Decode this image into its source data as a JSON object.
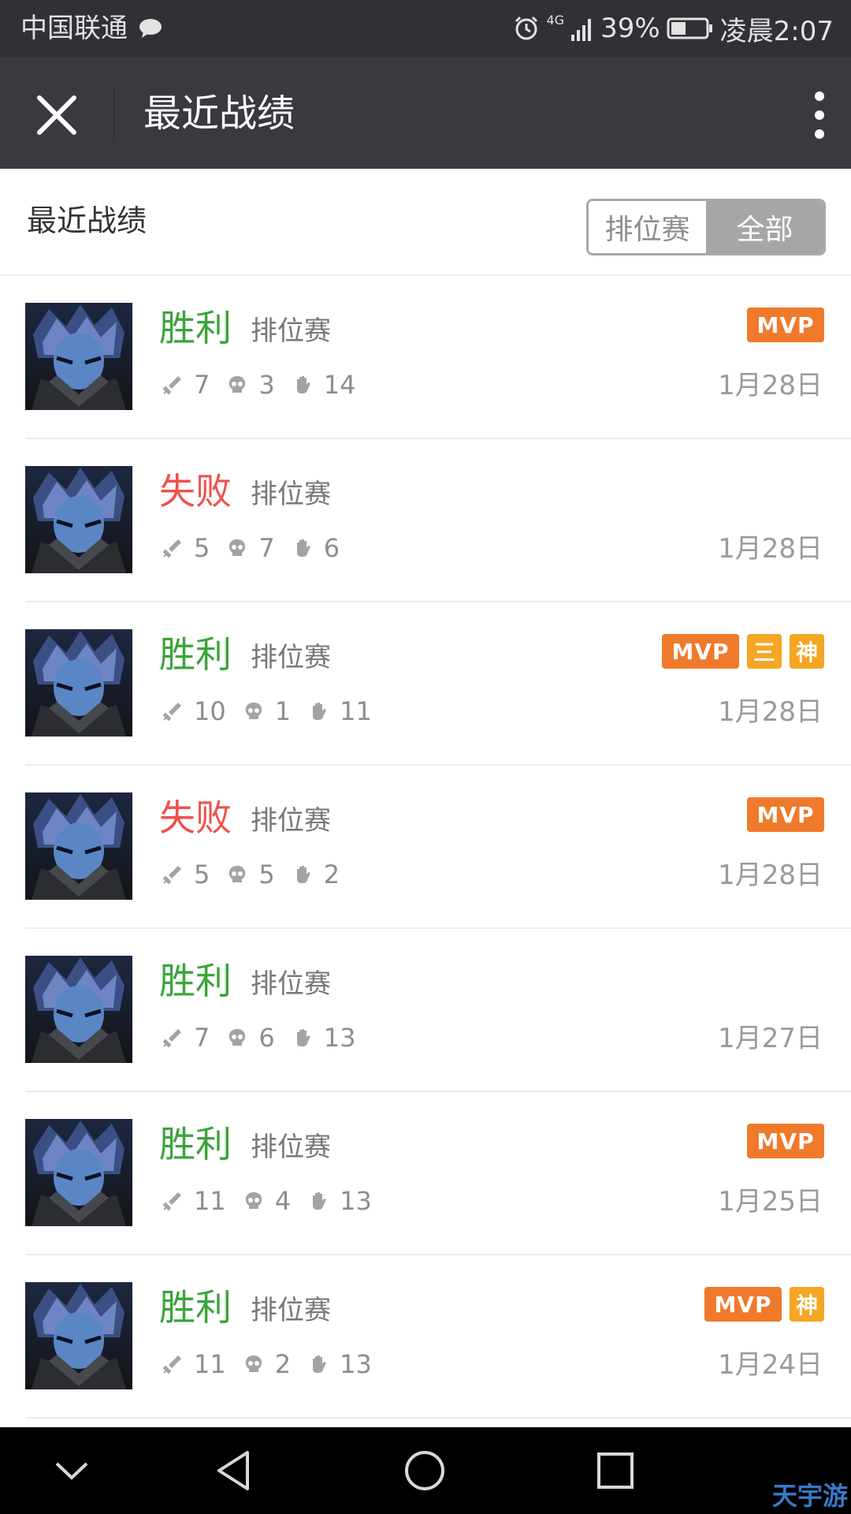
{
  "status_bar": {
    "carrier": "中国联通",
    "network": "4G",
    "battery": "39%",
    "time": "凌晨2:07"
  },
  "top_bar": {
    "title": "最近战绩"
  },
  "header": {
    "title": "最近战绩",
    "filters": [
      "排位赛",
      "全部"
    ],
    "selected_filter": "全部"
  },
  "records": [
    {
      "result": "胜利",
      "outcome": "win",
      "mode": "排位赛",
      "kills": "7",
      "deaths": "3",
      "assists": "14",
      "date": "1月28日",
      "badges": [
        "MVP"
      ]
    },
    {
      "result": "失败",
      "outcome": "loss",
      "mode": "排位赛",
      "kills": "5",
      "deaths": "7",
      "assists": "6",
      "date": "1月28日",
      "badges": []
    },
    {
      "result": "胜利",
      "outcome": "win",
      "mode": "排位赛",
      "kills": "10",
      "deaths": "1",
      "assists": "11",
      "date": "1月28日",
      "badges": [
        "MVP",
        "三",
        "神"
      ]
    },
    {
      "result": "失败",
      "outcome": "loss",
      "mode": "排位赛",
      "kills": "5",
      "deaths": "5",
      "assists": "2",
      "date": "1月28日",
      "badges": [
        "MVP"
      ]
    },
    {
      "result": "胜利",
      "outcome": "win",
      "mode": "排位赛",
      "kills": "7",
      "deaths": "6",
      "assists": "13",
      "date": "1月27日",
      "badges": []
    },
    {
      "result": "胜利",
      "outcome": "win",
      "mode": "排位赛",
      "kills": "11",
      "deaths": "4",
      "assists": "13",
      "date": "1月25日",
      "badges": [
        "MVP"
      ]
    },
    {
      "result": "胜利",
      "outcome": "win",
      "mode": "排位赛",
      "kills": "11",
      "deaths": "2",
      "assists": "13",
      "date": "1月24日",
      "badges": [
        "MVP",
        "神"
      ]
    }
  ],
  "badge_labels": {
    "mvp": "MVP"
  },
  "colors": {
    "win": "#3aa43a",
    "loss": "#f0504c",
    "mvp": "#f07a2b",
    "tag": "#f5a623",
    "top_bar": "#393a3f",
    "status_bar": "#2f3136"
  },
  "icons": {
    "kills": "sword-icon",
    "deaths": "skull-icon",
    "assists": "hand-icon"
  },
  "nav_bar": {
    "buttons": [
      "chevron-down-icon",
      "back-triangle-icon",
      "home-circle-icon",
      "recents-square-icon"
    ],
    "watermark": "天宇游"
  }
}
